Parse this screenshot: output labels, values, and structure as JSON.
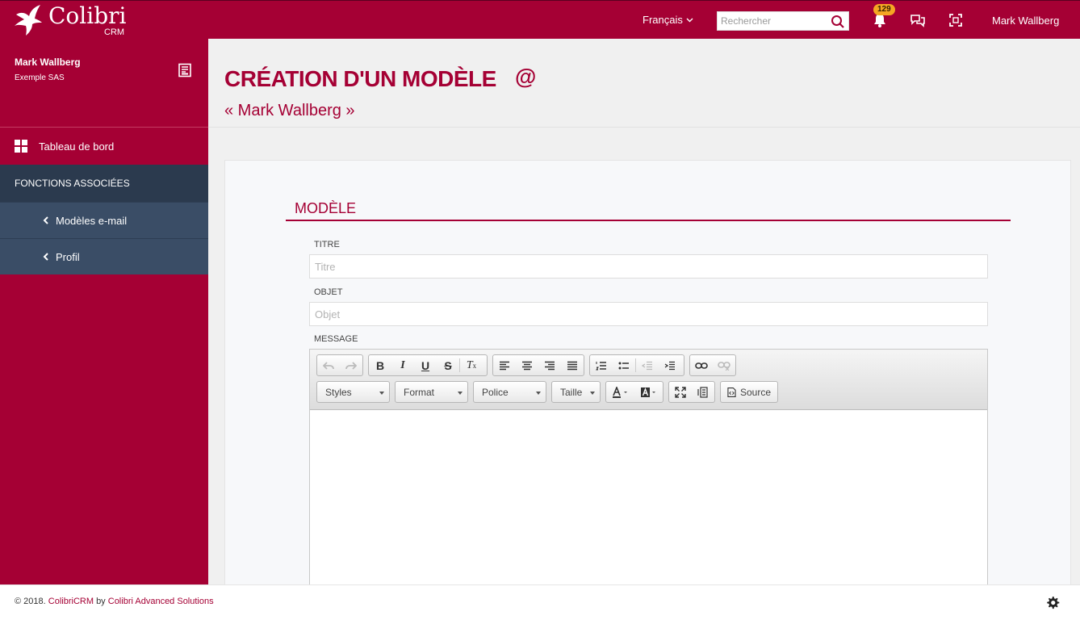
{
  "brand": {
    "name": "Colibri",
    "sub": "CRM"
  },
  "topbar": {
    "language": "Français",
    "search_placeholder": "Rechercher",
    "notification_count": "129",
    "user": "Mark Wallberg",
    "accent": "#a50034"
  },
  "sidebar": {
    "user_name": "Mark Wallberg",
    "company": "Exemple SAS",
    "dashboard": "Tableau de bord",
    "section": "FONCTIONS ASSOCIÉES",
    "items": [
      {
        "label": "Modèles e-mail"
      },
      {
        "label": "Profil"
      }
    ]
  },
  "page": {
    "title": "CRÉATION D'UN MODÈLE",
    "icon": "@",
    "subtitle": "« Mark Wallberg »"
  },
  "form": {
    "section_title": "MODÈLE",
    "title_label": "TITRE",
    "title_placeholder": "Titre",
    "subject_label": "OBJET",
    "subject_placeholder": "Objet",
    "message_label": "MESSAGE"
  },
  "editor": {
    "combos": [
      "Styles",
      "Format",
      "Police",
      "Taille"
    ],
    "source_label": "Source"
  },
  "footer": {
    "prefix": "© 2018.",
    "product": "ColibriCRM",
    "by": "by",
    "company": "Colibri Advanced Solutions"
  }
}
